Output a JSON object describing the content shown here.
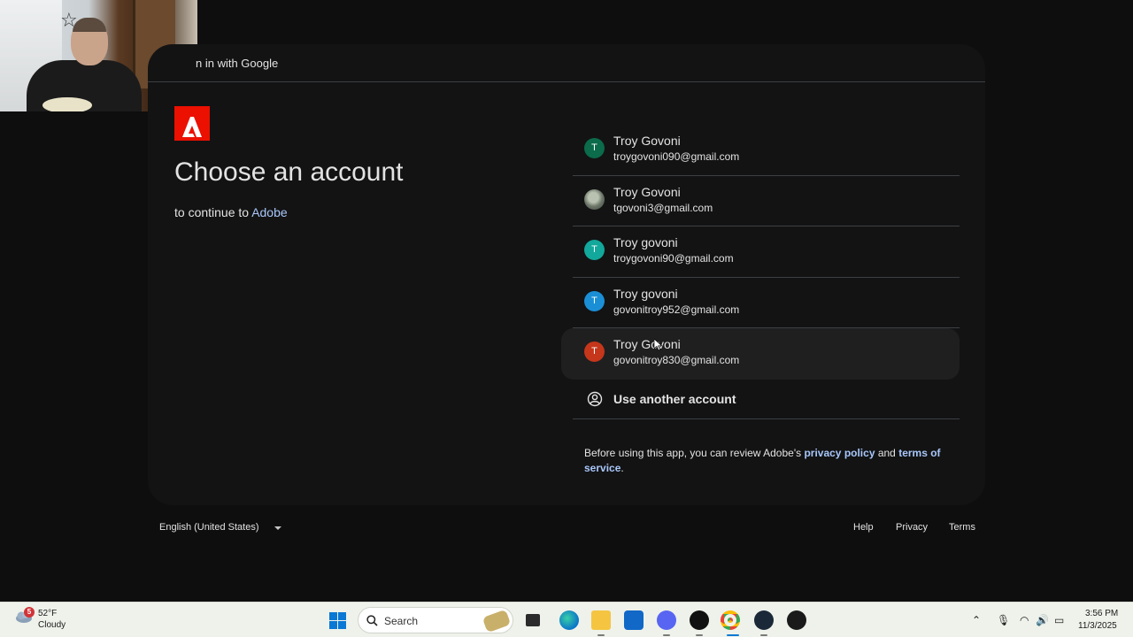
{
  "window": {
    "header_text": "n in with Google"
  },
  "main": {
    "title": "Choose an account",
    "subtitle_prefix": "to continue to ",
    "subtitle_link": "Adobe"
  },
  "accounts": [
    {
      "initial": "T",
      "name": "Troy Govoni",
      "email": "troygovoni090@gmail.com",
      "avatar_color": "#0b6b4a"
    },
    {
      "initial": "",
      "name": "Troy Govoni",
      "email": "tgovoni3@gmail.com",
      "avatar_color": "photo"
    },
    {
      "initial": "T",
      "name": "Troy govoni",
      "email": "troygovoni90@gmail.com",
      "avatar_color": "#12a89b"
    },
    {
      "initial": "T",
      "name": "Troy govoni",
      "email": "govonitroy952@gmail.com",
      "avatar_color": "#1a8fd6"
    },
    {
      "initial": "T",
      "name": "Troy Govoni",
      "email": "govonitroy830@gmail.com",
      "avatar_color": "#c5361b"
    }
  ],
  "use_another": {
    "label": "Use another account",
    "icon": "account-circle-icon"
  },
  "legal": {
    "prefix": "Before using this app, you can review Adobe's ",
    "privacy_link": "privacy policy",
    "middle": " and ",
    "terms_link": "terms of service",
    "suffix": "."
  },
  "footer": {
    "language": "English (United States)",
    "help": "Help",
    "privacy": "Privacy",
    "terms": "Terms"
  },
  "taskbar": {
    "weather_temp": "52°F",
    "weather_desc": "Cloudy",
    "weather_badge": "5",
    "search_label": "Search",
    "time": "3:56 PM",
    "date": "11/3/2025",
    "apps": [
      "task-view-icon",
      "edge-icon",
      "file-explorer-icon",
      "store-icon",
      "discord-icon",
      "g-hub-icon",
      "chrome-icon",
      "steam-icon",
      "app-icon"
    ]
  },
  "colors": {
    "background": "#0e0e0e",
    "card": "#131314",
    "link": "#a8c7fa",
    "adobe_red": "#eb1000"
  }
}
